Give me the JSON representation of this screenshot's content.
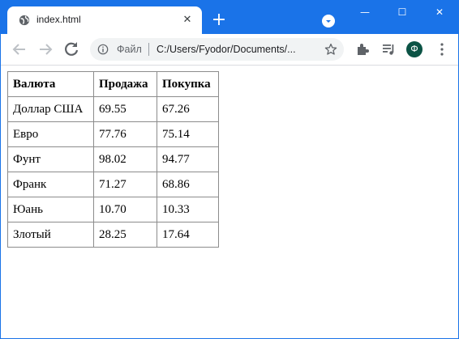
{
  "tab": {
    "title": "index.html",
    "close_glyph": "✕",
    "new_tab_glyph": "+"
  },
  "window_controls": {
    "minimize": "—",
    "maximize": "☐",
    "close": "✕"
  },
  "address_bar": {
    "scheme_label": "Файл",
    "url": "C:/Users/Fyodor/Documents/..."
  },
  "profile": {
    "initial": "Ф",
    "color": "#0b5345"
  },
  "icons": [
    "globe-icon",
    "close-icon",
    "plus-icon",
    "tab-search-icon",
    "back-arrow-icon",
    "forward-arrow-icon",
    "reload-icon",
    "info-icon",
    "star-icon",
    "extensions-icon",
    "reading-list-icon",
    "menu-icon"
  ],
  "colors": {
    "chrome_accent": "#1a73e8",
    "table_border": "#8c8c8c"
  },
  "table": {
    "headers": [
      "Валюта",
      "Продажа",
      "Покупка"
    ],
    "rows": [
      [
        "Доллар США",
        "69.55",
        "67.26"
      ],
      [
        "Евро",
        "77.76",
        "75.14"
      ],
      [
        "Фунт",
        "98.02",
        "94.77"
      ],
      [
        "Франк",
        "71.27",
        "68.86"
      ],
      [
        "Юань",
        "10.70",
        "10.33"
      ],
      [
        "Злотый",
        "28.25",
        "17.64"
      ]
    ]
  }
}
